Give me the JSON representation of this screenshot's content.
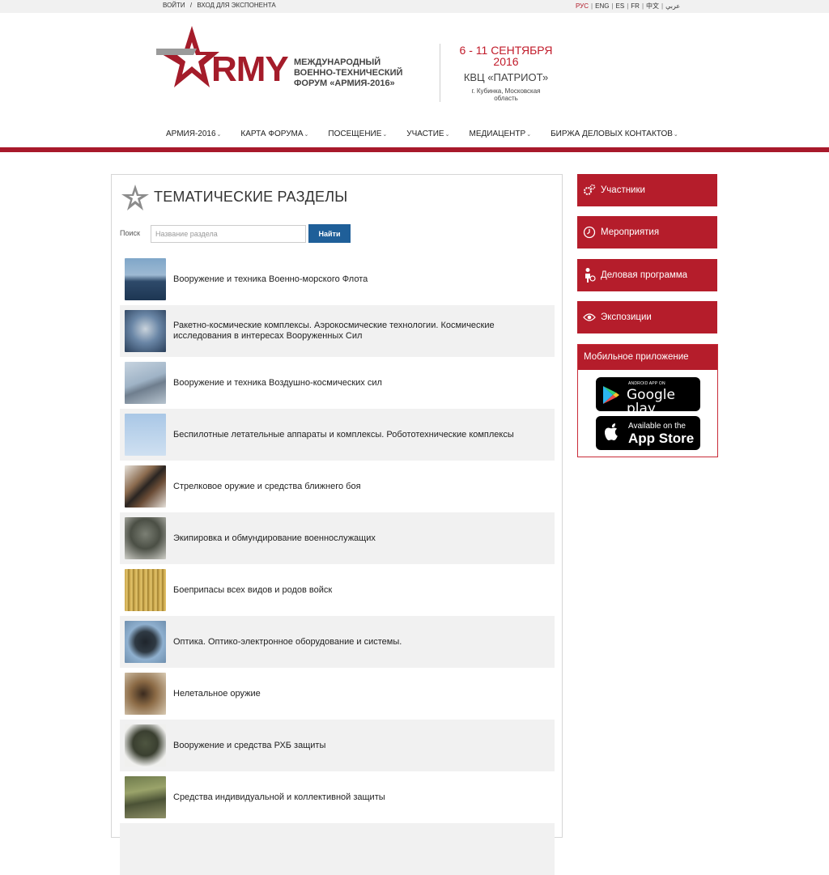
{
  "topbar": {
    "login": "Войти",
    "divider": "/",
    "exhibitor_login": "Вход для экспонента",
    "languages": [
      "РУС",
      "ENG",
      "ES",
      "FR",
      "中文",
      "عربي"
    ],
    "active_language": "РУС"
  },
  "header": {
    "logo_text": "RMY",
    "forum_line1": "Международный",
    "forum_line2": "военно-технический",
    "forum_line3": "форум «Армия-2016»",
    "dates_line1": "6 - 11 СЕНТЯБРЯ",
    "dates_line2": "2016",
    "venue": "КВЦ «ПАТРИОТ»",
    "place": "г. Кубинка, Московская область"
  },
  "nav": {
    "items": [
      "Армия-2016",
      "Карта форума",
      "Посещение",
      "Участие",
      "Медиацентр",
      "Биржа деловых контактов"
    ]
  },
  "main": {
    "title": "Тематические разделы",
    "search_label": "Поиск",
    "search_placeholder": "Название раздела",
    "search_button": "Найти",
    "sections": [
      {
        "label": "Вооружение и техника Военно-морского Флота"
      },
      {
        "label": "Ракетно-космические комплексы. Аэрокосмические технологии. Космические исследования в интересах Вооруженных Сил"
      },
      {
        "label": "Вооружение и техника Воздушно-космических сил"
      },
      {
        "label": "Беспилотные летательные аппараты и комплексы. Робототехнические комплексы"
      },
      {
        "label": "Стрелковое оружие и средства ближнего боя"
      },
      {
        "label": "Экипировка и обмундирование военнослужащих"
      },
      {
        "label": "Боеприпасы всех видов и родов войск"
      },
      {
        "label": "Оптика. Оптико-электронное оборудование и системы."
      },
      {
        "label": "Нелетальное оружие"
      },
      {
        "label": "Вооружение и средства РХБ защиты"
      },
      {
        "label": "Средства индивидуальной и коллективной защиты"
      }
    ]
  },
  "sidebar": {
    "participants": "Участники",
    "events": "Мероприятия",
    "business_program": "Деловая программа",
    "expositions": "Экспозиции",
    "mobile_app": "Мобильное приложение",
    "google_small": "ANDROID APP ON",
    "google_big": "Google play",
    "apple_small": "Available on the",
    "apple_big": "App Store"
  },
  "colors": {
    "brand_red": "#b51d2b",
    "search_button_blue": "#1f5f99",
    "row_alt_bg": "#f1f1f1"
  }
}
